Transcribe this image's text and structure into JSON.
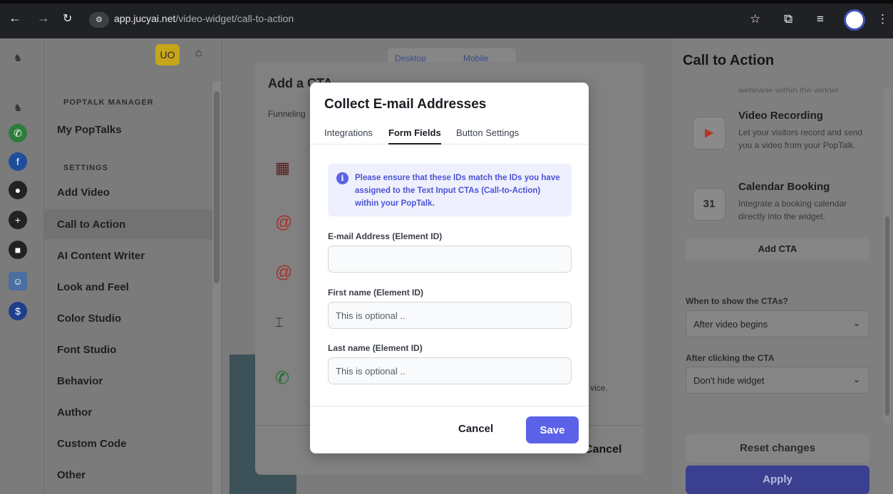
{
  "browser": {
    "url_host": "app.jucyai.net",
    "url_path": "/video-widget/call-to-action"
  },
  "sidebar": {
    "badge": "UO",
    "section_manager": "POPTALK MANAGER",
    "section_settings": "SETTINGS",
    "items": [
      {
        "label": "My PopTalks"
      },
      {
        "label": "Add Video"
      },
      {
        "label": "Call to Action"
      },
      {
        "label": "AI Content Writer"
      },
      {
        "label": "Look and Feel"
      },
      {
        "label": "Color Studio"
      },
      {
        "label": "Font Studio"
      },
      {
        "label": "Behavior"
      },
      {
        "label": "Author"
      },
      {
        "label": "Custom Code"
      },
      {
        "label": "Other"
      }
    ]
  },
  "main": {
    "device_tabs": [
      "Desktop",
      "Mobile"
    ]
  },
  "outer_modal": {
    "title": "Add a CTA",
    "tab": "Funneling",
    "cancel": "Cancel",
    "desc_fragment": "vice."
  },
  "modal": {
    "title": "Collect E-mail Addresses",
    "tabs": [
      "Integrations",
      "Form Fields",
      "Button Settings"
    ],
    "active_tab": "Form Fields",
    "info": "Please ensure that these IDs match the IDs you have assigned to the Text Input CTAs (Call-to-Action) within your PopTalk.",
    "fields": [
      {
        "label": "E-mail Address (Element ID)",
        "value": "",
        "placeholder": ""
      },
      {
        "label": "First name (Element ID)",
        "value": "",
        "placeholder": "This is optional .."
      },
      {
        "label": "Last name (Element ID)",
        "value": "",
        "placeholder": "This is optional .."
      }
    ],
    "cancel": "Cancel",
    "save": "Save",
    "accent": "#5b62e8"
  },
  "right_panel": {
    "title": "Call to Action",
    "truncated_desc": "webpage within the widget.",
    "cards": [
      {
        "title": "Video Recording",
        "desc": "Let your visitors record and send you a video from your PopTalk."
      },
      {
        "title": "Calendar Booking",
        "desc": "Integrate a booking calendar directly into the widget."
      }
    ],
    "calendar_day": "31",
    "add_cta": "Add CTA",
    "when_label": "When to show the CTAs?",
    "when_value": "After video begins",
    "after_label": "After clicking the CTA",
    "after_value": "Don't hide widget",
    "reset": "Reset changes",
    "apply": "Apply"
  }
}
